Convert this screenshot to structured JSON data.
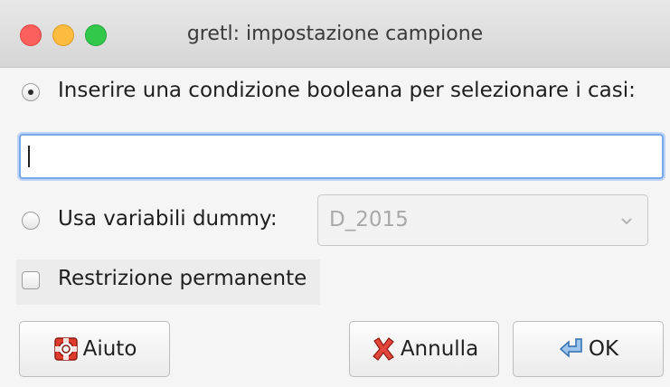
{
  "window": {
    "title": "gretl: impostazione campione"
  },
  "options": {
    "boolean_label": "Inserire una condizione booleana per selezionare i casi:",
    "boolean_selected": true,
    "boolean_input_value": "",
    "dummy_label": "Usa variabili dummy:",
    "dummy_selected": false,
    "dummy_select_value": "D_2015",
    "permanent_label": "Restrizione permanente",
    "permanent_checked": false
  },
  "buttons": {
    "help_label": "Aiuto",
    "help_icon": "lifebuoy-icon",
    "cancel_label": "Annulla",
    "cancel_icon": "red-x-icon",
    "ok_label": "OK",
    "ok_icon": "return-arrow-icon"
  },
  "colors": {
    "close": "#fc605c",
    "minimize": "#fdbc40",
    "maximize": "#34c84a",
    "focus_ring": "#7aa7e8"
  }
}
